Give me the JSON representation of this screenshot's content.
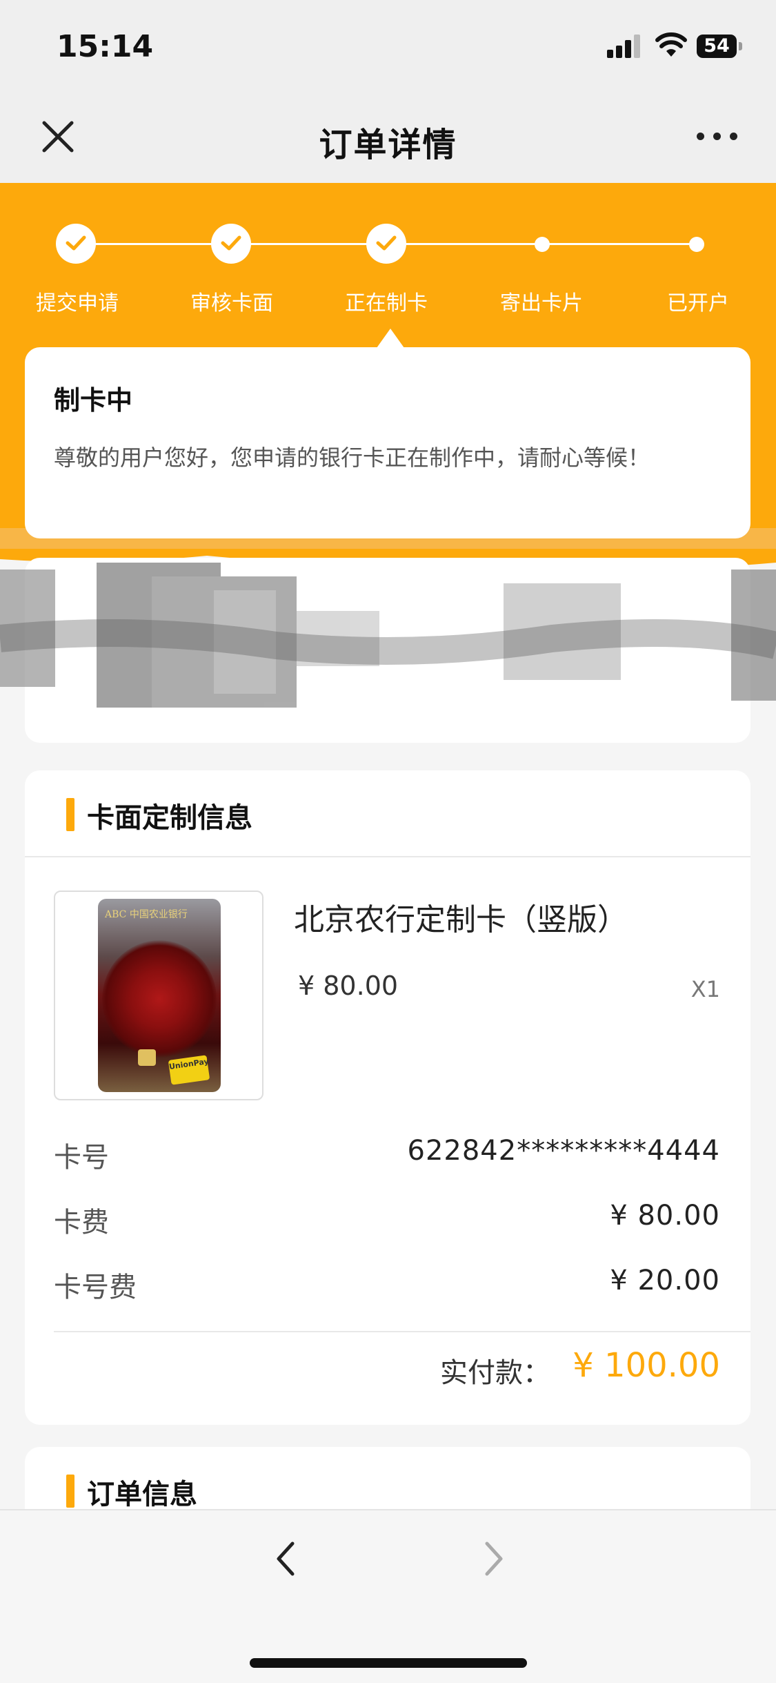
{
  "status_bar": {
    "time": "15:14",
    "battery": "54"
  },
  "nav": {
    "title": "订单详情"
  },
  "progress": {
    "steps": [
      {
        "label": "提交申请",
        "done": true
      },
      {
        "label": "审核卡面",
        "done": true
      },
      {
        "label": "正在制卡",
        "done": true
      },
      {
        "label": "寄出卡片",
        "done": false
      },
      {
        "label": "已开户",
        "done": false
      }
    ],
    "current_index": 2
  },
  "status_card": {
    "title": "制卡中",
    "description": "尊敬的用户您好，您申请的银行卡正在制作中，请耐心等候！"
  },
  "card_info": {
    "section_title": "卡面定制信息",
    "product": {
      "name": "北京农行定制卡（竖版）",
      "price": "¥ 80.00",
      "qty": "X1",
      "card_header_text": "ABC 中国农业银行",
      "card_brand": "UnionPay"
    },
    "rows": [
      {
        "label": "卡号",
        "value": "622842*********4444"
      },
      {
        "label": "卡费",
        "value": "¥ 80.00"
      },
      {
        "label": "卡号费",
        "value": "¥ 20.00"
      }
    ],
    "total_label": "实付款：",
    "total_value": "¥ 100.00"
  },
  "order_info": {
    "section_title": "订单信息"
  },
  "colors": {
    "accent": "#fda90c",
    "background": "#f5f5f5"
  },
  "icons": [
    "close-icon",
    "more-icon",
    "check-icon",
    "back-arrow-icon",
    "forward-arrow-icon"
  ]
}
